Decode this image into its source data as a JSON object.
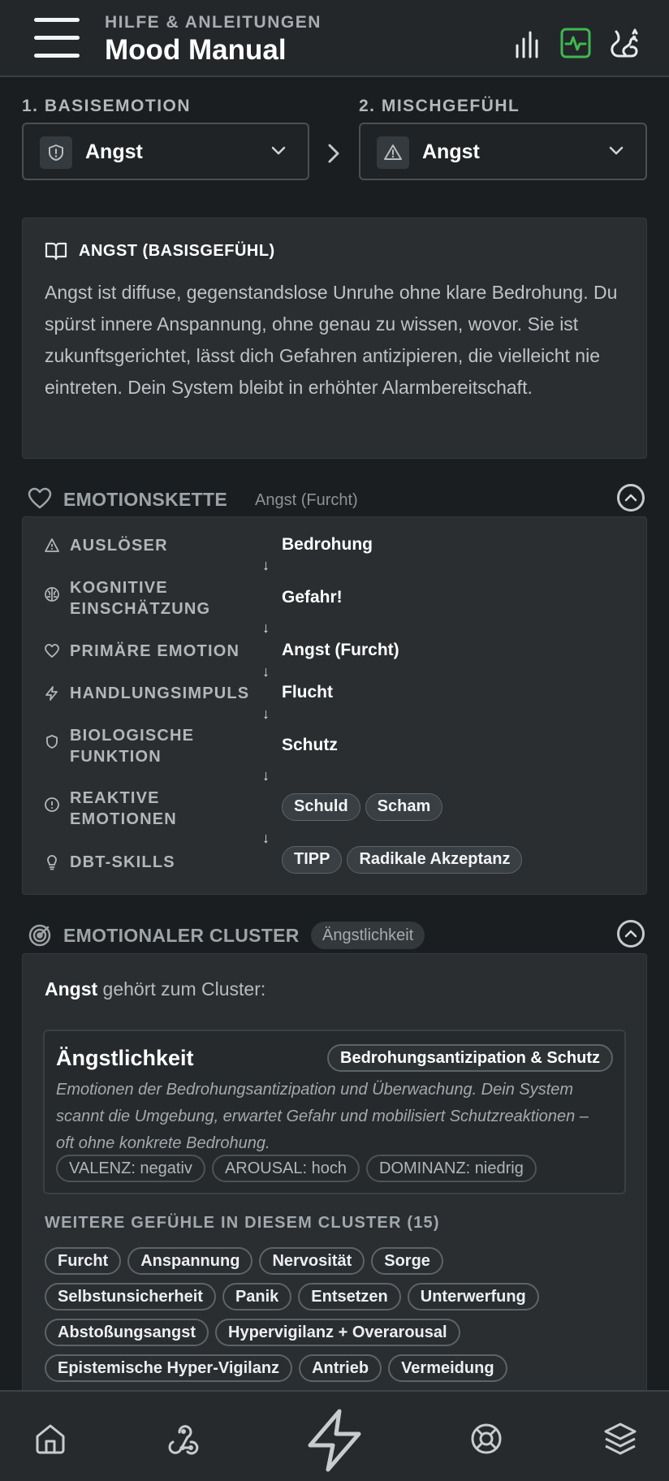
{
  "header": {
    "subtitle": "HILFE & ANLEITUNGEN",
    "title": "Mood Manual",
    "accent_color": "#3fb950"
  },
  "selectors": {
    "base_label": "1. BASISEMOTION",
    "base_value": "Angst",
    "mix_label": "2. MISCHGEFÜHL",
    "mix_value": "Angst"
  },
  "definition": {
    "title": "ANGST (BASISGEFÜHL)",
    "text": "Angst ist diffuse, gegenstandslose Unruhe ohne klare Bedrohung. Du spürst innere Anspannung, ohne genau zu wissen, wovor. Sie ist zukunftsgerichtet, lässt dich Gefahren antizipieren, die vielleicht nie eintreten. Dein System bleibt in erhöhter Alarmbereitschaft."
  },
  "chain": {
    "title": "EMOTIONSKETTE",
    "subtitle": "Angst (Furcht)",
    "rows": [
      {
        "label": "AUSLÖSER",
        "value": "Bedrohung"
      },
      {
        "label": "KOGNITIVE EINSCHÄTZUNG",
        "value": "Gefahr!"
      },
      {
        "label": "PRIMÄRE EMOTION",
        "value": "Angst (Furcht)"
      },
      {
        "label": "HANDLUNGSIMPULS",
        "value": "Flucht"
      },
      {
        "label": "BIOLOGISCHE FUNKTION",
        "value": "Schutz"
      },
      {
        "label": "REAKTIVE EMOTIONEN",
        "pills": [
          "Schuld",
          "Scham"
        ]
      },
      {
        "label": "DBT-SKILLS",
        "pills": [
          "TIPP",
          "Radikale Akzeptanz"
        ]
      }
    ],
    "arrow": "↓"
  },
  "cluster": {
    "title": "EMOTIONALER CLUSTER",
    "badge": "Ängstlichkeit",
    "intro_bold": "Angst",
    "intro_rest": " gehört zum Cluster:",
    "name": "Ängstlichkeit",
    "tag": "Bedrohungsantizipation & Schutz",
    "description": "Emotionen der Bedrohungsantizipation und Überwachung. Dein System scannt die Umgebung, erwartet Gefahr und mobilisiert Schutzreaktionen – oft ohne konkrete Bedrohung.",
    "dims": [
      "VALENZ: negativ",
      "AROUSAL: hoch",
      "DOMINANZ: niedrig"
    ],
    "more_title": "WEITERE GEFÜHLE IN DIESEM CLUSTER (15)",
    "more": [
      "Furcht",
      "Anspannung",
      "Nervosität",
      "Sorge",
      "Selbstunsicherheit",
      "Panik",
      "Entsetzen",
      "Unterwerfung",
      "Abstoßungsangst",
      "Hypervigilanz + Overarousal",
      "Epistemische Hyper-Vigilanz",
      "Antrieb",
      "Vermeidung"
    ]
  },
  "nav": {
    "items": [
      "home-icon",
      "webhook-icon",
      "lightning-icon",
      "lifebuoy-icon",
      "layers-icon"
    ]
  }
}
